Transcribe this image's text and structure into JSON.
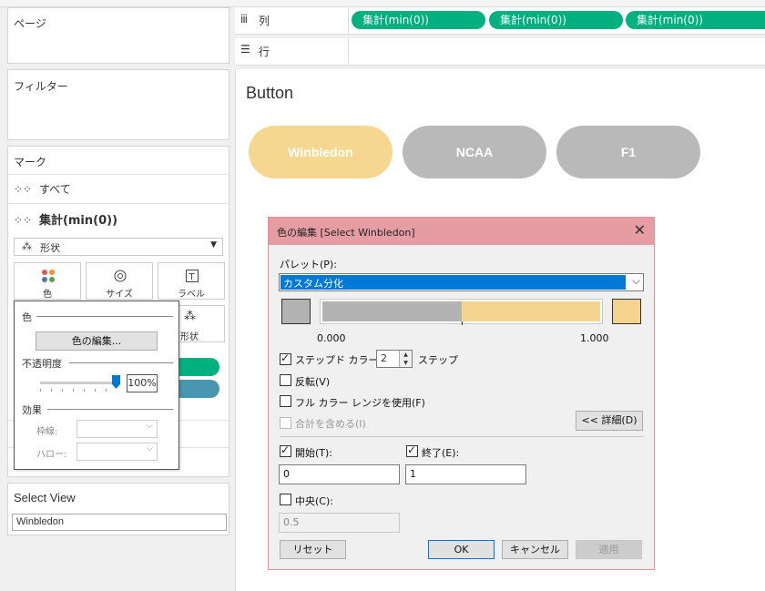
{
  "left_panel": {
    "pages_title": "ページ",
    "filters_title": "フィルター",
    "marks_title": "マーク",
    "marks_all": "すべて",
    "marks_aggregate": "集計(min(0))",
    "mark_type": "形状",
    "mark_buttons": {
      "color": "色",
      "size": "サイズ",
      "label": "ラベル",
      "shape": "形状"
    }
  },
  "color_popup": {
    "color_header": "色",
    "edit_colors_button": "色の編集...",
    "opacity_header": "不透明度",
    "opacity_value": "100%",
    "opacity_level": 1.0,
    "effects_header": "効果",
    "border_label": "枠線:",
    "halo_label": "ハロー:"
  },
  "select_view": {
    "title": "Select View",
    "value": "Winbledon"
  },
  "shelves": {
    "columns_label": "列",
    "rows_label": "行",
    "column_pills": [
      "集計(min(0))",
      "集計(min(0))",
      "集計(min(0))"
    ]
  },
  "worksheet": {
    "title": "Button",
    "buttons": [
      {
        "label": "Winbledon",
        "color": "#f5d78f"
      },
      {
        "label": "NCAA",
        "color": "#b9b9b9"
      },
      {
        "label": "F1",
        "color": "#b9b9b9"
      }
    ]
  },
  "dialog": {
    "title": "色の編集 [Select Winbledon]",
    "palette_label": "パレット(P):",
    "palette_value": "カスタム分化",
    "gradient": {
      "start_color": "#b3b3b3",
      "end_color": "#f5d48f",
      "min_label": "0.000",
      "max_label": "1.000"
    },
    "stepped_label": "ステップド カラー(S)",
    "stepped_checked": true,
    "steps_value": "2",
    "steps_suffix": "ステップ",
    "reverse_label": "反転(V)",
    "full_range_label": "フル カラー レンジを使用(F)",
    "include_totals_label": "合計を含める(I)",
    "details_button": "<< 詳細(D)",
    "start_label": "開始(T):",
    "start_value": "0",
    "end_label": "終了(E):",
    "end_value": "1",
    "center_label": "中央(C):",
    "center_value": "0.5",
    "reset_button": "リセット",
    "ok_button": "OK",
    "cancel_button": "キャンセル",
    "apply_button": "適用",
    "accent_color": "#0078d7"
  }
}
